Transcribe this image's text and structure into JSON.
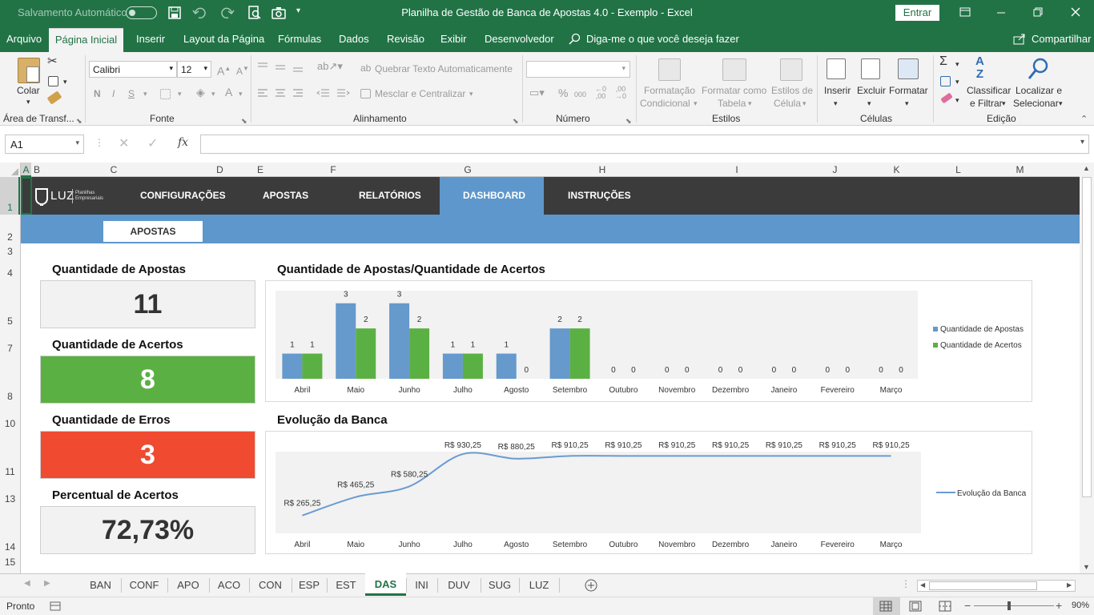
{
  "titlebar": {
    "autosave_label": "Salvamento Automático",
    "autosave_state": "off",
    "title": "Planilha de Gestão de Banca de Apostas 4.0 - Exemplo  -  Excel",
    "signin_label": "Entrar"
  },
  "menu": {
    "items": [
      "Arquivo",
      "Página Inicial",
      "Inserir",
      "Layout da Página",
      "Fórmulas",
      "Dados",
      "Revisão",
      "Exibir",
      "Desenvolvedor"
    ],
    "tell_me": "Diga-me o que você deseja fazer",
    "share": "Compartilhar"
  },
  "ribbon": {
    "paste": "Colar",
    "clipboard_group": "Área de Transf...",
    "font_name": "Calibri",
    "font_size": "12",
    "font_group": "Fonte",
    "bold": "N",
    "italic": "I",
    "underline": "S",
    "wrap_text": "Quebrar Texto Automaticamente",
    "merge_center": "Mesclar e Centralizar",
    "alignment_group": "Alinhamento",
    "number_group": "Número",
    "cond_format_1": "Formatação",
    "cond_format_2": "Condicional",
    "format_table_1": "Formatar como",
    "format_table_2": "Tabela",
    "cell_styles_1": "Estilos de",
    "cell_styles_2": "Célula",
    "styles_group": "Estilos",
    "insert": "Inserir",
    "delete": "Excluir",
    "format": "Formatar",
    "cells_group": "Células",
    "sort_1": "Classificar",
    "sort_2": "e Filtrar",
    "find_1": "Localizar e",
    "find_2": "Selecionar",
    "editing_group": "Edição"
  },
  "formula_bar": {
    "name_box": "A1",
    "fx": "fx",
    "value": ""
  },
  "columns": [
    "A",
    "B",
    "C",
    "D",
    "E",
    "F",
    "G",
    "H",
    "I",
    "J",
    "K",
    "L",
    "M"
  ],
  "rows": [
    "1",
    "2",
    "3",
    "4",
    "5",
    "7",
    "8",
    "10",
    "11",
    "13",
    "14",
    "15"
  ],
  "nav": {
    "items": [
      "CONFIGURAÇÕES",
      "APOSTAS",
      "RELATÓRIOS",
      "DASHBOARD",
      "INSTRUÇÕES"
    ],
    "logo": "LUZ",
    "logo_sub_1": "Planilhas",
    "logo_sub_2": "Empresariais",
    "subtab": "APOSTAS"
  },
  "kpis": {
    "apostas": {
      "label": "Quantidade de Apostas",
      "value": "11",
      "bg": "#f2f2f2",
      "color": "#333333"
    },
    "acertos": {
      "label": "Quantidade de Acertos",
      "value": "8",
      "bg": "#5bb043",
      "color": "#ffffff"
    },
    "erros": {
      "label": "Quantidade de Erros",
      "value": "3",
      "bg": "#f04a30",
      "color": "#ffffff"
    },
    "percentual": {
      "label": "Percentual de Acertos",
      "value": "72,73%",
      "bg": "#f2f2f2",
      "color": "#333333"
    }
  },
  "chart_data": [
    {
      "type": "bar",
      "title": "Quantidade de Apostas/Quantidade de Acertos",
      "categories": [
        "Abril",
        "Maio",
        "Junho",
        "Julho",
        "Agosto",
        "Setembro",
        "Outubro",
        "Novembro",
        "Dezembro",
        "Janeiro",
        "Fevereiro",
        "Março"
      ],
      "series": [
        {
          "name": "Quantidade de Apostas",
          "values": [
            1,
            3,
            3,
            1,
            1,
            2,
            0,
            0,
            0,
            0,
            0,
            0
          ],
          "color": "#6699cc"
        },
        {
          "name": "Quantidade de Acertos",
          "values": [
            1,
            2,
            2,
            1,
            0,
            2,
            0,
            0,
            0,
            0,
            0,
            0
          ],
          "color": "#5bb043"
        }
      ],
      "ylim": [
        0,
        3.5
      ],
      "legend": "right",
      "grid": false
    },
    {
      "type": "line",
      "title": "Evolução da Banca",
      "categories": [
        "Abril",
        "Maio",
        "Junho",
        "Julho",
        "Agosto",
        "Setembro",
        "Outubro",
        "Novembro",
        "Dezembro",
        "Janeiro",
        "Fevereiro",
        "Março"
      ],
      "series": [
        {
          "name": "Evolução da Banca",
          "values": [
            265.25,
            465.25,
            580.25,
            930.25,
            880.25,
            910.25,
            910.25,
            910.25,
            910.25,
            910.25,
            910.25,
            910.25
          ],
          "color": "#6a9bd1"
        }
      ],
      "labels": [
        "R$ 265,25",
        "R$ 465,25",
        "R$ 580,25",
        "R$ 930,25",
        "R$ 880,25",
        "R$ 910,25",
        "R$ 910,25",
        "R$ 910,25",
        "R$ 910,25",
        "R$ 910,25",
        "R$ 910,25",
        "R$ 910,25"
      ],
      "ylim": [
        0,
        1000
      ],
      "legend": "right",
      "grid": false
    }
  ],
  "sheet_tabs": {
    "items": [
      "BAN",
      "CONF",
      "APO",
      "ACO",
      "CON",
      "ESP",
      "EST",
      "DAS",
      "INI",
      "DUV",
      "SUG",
      "LUZ"
    ],
    "active": "DAS"
  },
  "status": {
    "ready": "Pronto",
    "zoom": "90%"
  }
}
